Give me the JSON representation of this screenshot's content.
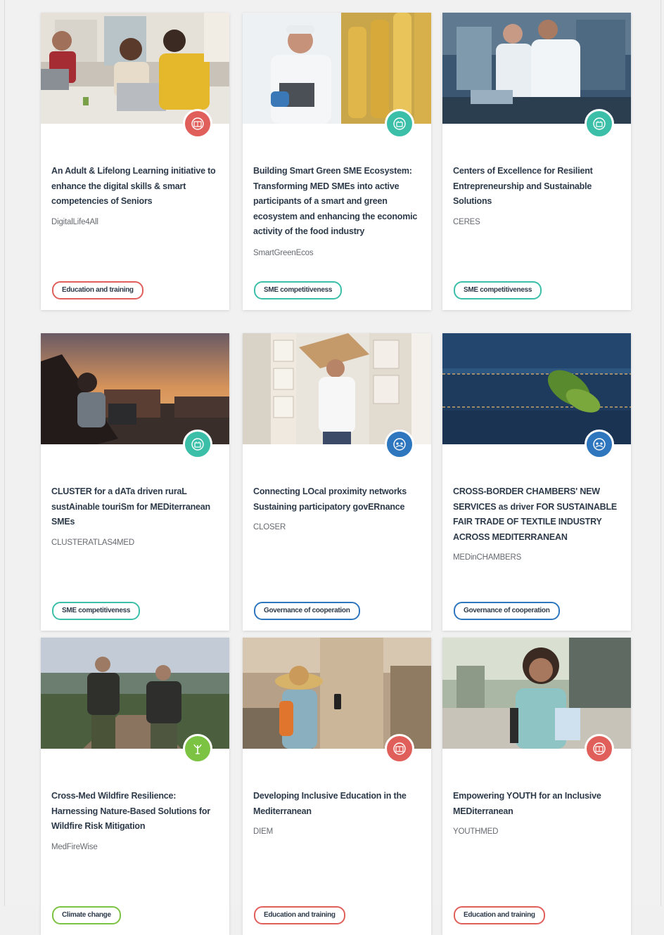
{
  "colors": {
    "education": "#e05f5a",
    "sme": "#3bbfa8",
    "governance": "#2e76bd",
    "climate": "#7cc243"
  },
  "cards": [
    {
      "title": "An Adult & Lifelong Learning initiative to enhance the digital skills & smart competencies of Seniors",
      "acronym": "DigitalLife4All",
      "tag": "Education and training",
      "badge_icon": "education-icon"
    },
    {
      "title": "Building Smart Green SME Ecosystem: Transforming MED SMEs into active participants of a smart and green ecosystem and enhancing the economic activity of the food industry",
      "acronym": "SmartGreenEcos",
      "tag": "SME competitiveness",
      "badge_icon": "sme-icon"
    },
    {
      "title": "Centers of Excellence for Resilient Entrepreneurship and Sustainable Solutions",
      "acronym": "CERES",
      "tag": "SME competitiveness",
      "badge_icon": "sme-icon"
    },
    {
      "title": "CLUSTER for a dATa driven ruraL sustAinable touriSm for MEDiterranean SMEs",
      "acronym": "CLUSTERATLAS4MED",
      "tag": "SME competitiveness",
      "badge_icon": "sme-icon"
    },
    {
      "title": "Connecting LOcal proximity networks Sustaining participatory govERnance",
      "acronym": "CLOSER",
      "tag": "Governance of cooperation",
      "badge_icon": "governance-icon"
    },
    {
      "title": "CROSS-BORDER CHAMBERS' NEW SERVICES as driver FOR SUSTAINABLE FAIR TRADE OF TEXTILE INDUSTRY ACROSS MEDITERRANEAN",
      "acronym": "MEDinCHAMBERS",
      "tag": "Governance of cooperation",
      "badge_icon": "governance-icon"
    },
    {
      "title": "Cross-Med Wildfire Resilience: Harnessing Nature-Based Solutions for Wildfire Risk Mitigation",
      "acronym": "MedFireWise",
      "tag": "Climate change",
      "badge_icon": "climate-icon"
    },
    {
      "title": "Developing Inclusive Education in the Mediterranean",
      "acronym": "DIEM",
      "tag": "Education and training",
      "badge_icon": "education-icon"
    },
    {
      "title": "Empowering YOUTH for an Inclusive MEDiterranean",
      "acronym": "YOUTHMED",
      "tag": "Education and training",
      "badge_icon": "education-icon"
    }
  ]
}
